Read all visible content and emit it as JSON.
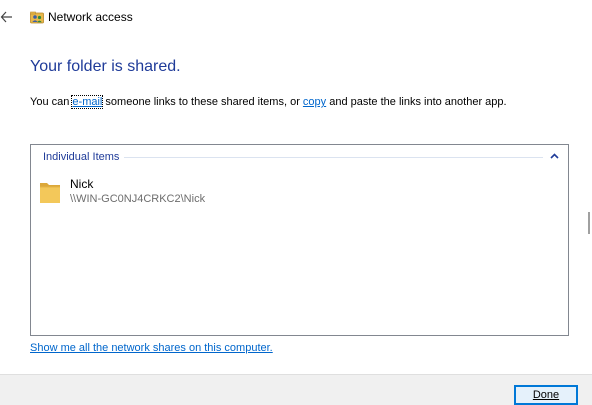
{
  "window": {
    "title": "Network access"
  },
  "main": {
    "heading": "Your folder is shared.",
    "description": {
      "prefix": "You can ",
      "email_link": "e-mail",
      "middle": " someone links to these shared items, or ",
      "copy_link": "copy",
      "suffix": " and paste the links into another app."
    }
  },
  "items_group": {
    "label": "Individual Items",
    "items": [
      {
        "name": "Nick",
        "path": "\\\\WIN-GC0NJ4CRKC2\\Nick",
        "icon": "folder-icon"
      }
    ]
  },
  "show_shares_link": "Show me all the network shares on this computer.",
  "footer": {
    "done_label": "Done"
  },
  "colors": {
    "heading": "#1f3b99",
    "link": "#0066cc",
    "button_border": "#0078d7",
    "button_bg": "#e5f1fb",
    "footer_bg": "#f0f0f0"
  }
}
